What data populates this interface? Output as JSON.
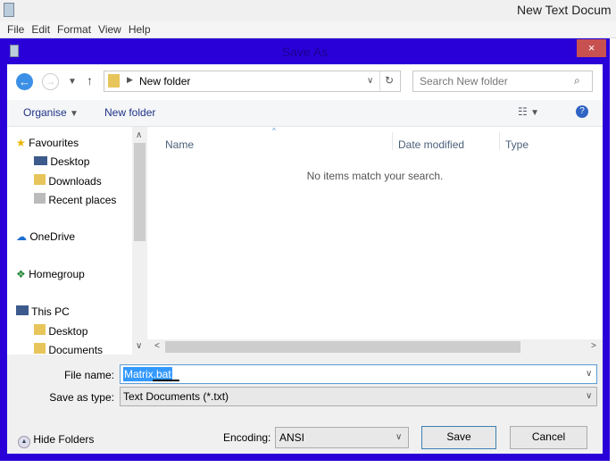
{
  "notepad": {
    "title": "New Text Docum",
    "menu": [
      "File",
      "Edit",
      "Format",
      "View",
      "Help"
    ]
  },
  "dialog": {
    "title": "Save As",
    "close": "×",
    "address": {
      "path": "New folder",
      "search_placeholder": "Search New folder"
    },
    "toolbar": {
      "organise": "Organise",
      "new_folder": "New folder"
    },
    "nav": {
      "favourites": "Favourites",
      "desktop": "Desktop",
      "downloads": "Downloads",
      "recent": "Recent places",
      "onedrive": "OneDrive",
      "homegroup": "Homegroup",
      "thispc": "This PC",
      "pc_desktop": "Desktop",
      "documents": "Documents"
    },
    "columns": {
      "name": "Name",
      "date": "Date modified",
      "type": "Type"
    },
    "empty": "No items match your search.",
    "file_name_label": "File name:",
    "file_name": "Matrix.bat",
    "save_type_label": "Save as type:",
    "save_type": "Text Documents (*.txt)",
    "hide_folders": "Hide Folders",
    "encoding_label": "Encoding:",
    "encoding": "ANSI",
    "save": "Save",
    "cancel": "Cancel"
  },
  "colors": {
    "dialog_border": "#2a00d8",
    "close": "#c75050",
    "selection": "#3399ff"
  }
}
